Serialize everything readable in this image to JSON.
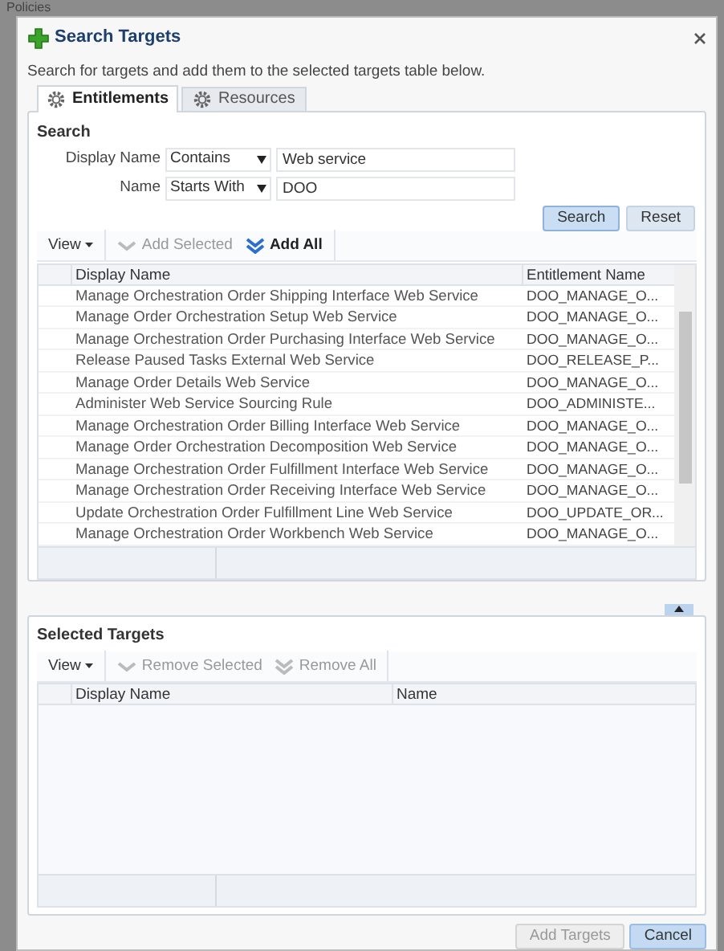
{
  "background_title": "Policies",
  "dialog": {
    "title": "Search Targets",
    "instructions": "Search for targets and add them to the selected targets table below."
  },
  "tabs": [
    {
      "label": "Entitlements",
      "selected": true
    },
    {
      "label": "Resources",
      "selected": false
    }
  ],
  "search": {
    "heading": "Search",
    "fields": [
      {
        "label": "Display Name",
        "operator": "Contains",
        "value": "Web service"
      },
      {
        "label": "Name",
        "operator": "Starts With",
        "value": "DOO"
      }
    ],
    "buttons": [
      {
        "label": "Search",
        "highlighted": true
      },
      {
        "label": "Reset",
        "highlighted": false
      }
    ]
  },
  "results_toolbar": {
    "view": "View",
    "actions": [
      {
        "label": "Add Selected",
        "disabled": true
      },
      {
        "label": "Add All",
        "disabled": false
      }
    ]
  },
  "results_table": {
    "columns": [
      "Display Name",
      "Entitlement Name"
    ],
    "rows": [
      [
        "Manage Orchestration Order Shipping Interface Web Service",
        "DOO_MANAGE_O..."
      ],
      [
        "Manage Order Orchestration Setup Web Service",
        "DOO_MANAGE_O..."
      ],
      [
        "Manage Orchestration Order Purchasing Interface Web Service",
        "DOO_MANAGE_O..."
      ],
      [
        "Release Paused Tasks External Web Service",
        "DOO_RELEASE_P..."
      ],
      [
        "Manage Order Details Web Service",
        "DOO_MANAGE_O..."
      ],
      [
        "Administer Web Service Sourcing Rule",
        "DOO_ADMINISTE..."
      ],
      [
        "Manage Orchestration Order Billing Interface Web Service",
        "DOO_MANAGE_O..."
      ],
      [
        "Manage Order Orchestration Decomposition Web Service",
        "DOO_MANAGE_O..."
      ],
      [
        "Manage Orchestration Order Fulfillment Interface Web Service",
        "DOO_MANAGE_O..."
      ],
      [
        "Manage Orchestration Order Receiving Interface Web Service",
        "DOO_MANAGE_O..."
      ],
      [
        "Update Orchestration Order Fulfillment Line Web Service",
        "DOO_UPDATE_OR..."
      ],
      [
        "Manage Orchestration Order Workbench Web Service",
        "DOO_MANAGE_O..."
      ]
    ]
  },
  "selected_targets": {
    "heading": "Selected Targets",
    "toolbar": {
      "view": "View",
      "actions": [
        {
          "label": "Remove Selected",
          "disabled": true
        },
        {
          "label": "Remove All",
          "disabled": true
        }
      ]
    },
    "columns": [
      "Display Name",
      "Name"
    ]
  },
  "footer_buttons": [
    {
      "label": "Add Targets",
      "disabled": true
    },
    {
      "label": "Cancel",
      "disabled": false
    }
  ]
}
